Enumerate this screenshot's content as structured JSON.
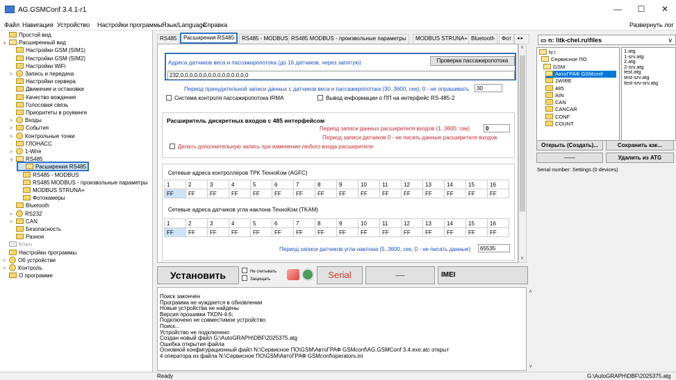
{
  "window": {
    "title": "AG.GSMConf 3.4.1-r1",
    "minimize": "—",
    "maximize": "☐",
    "close": "✕"
  },
  "menu": {
    "items": [
      "Файл",
      "Навигация",
      "Устройство",
      "Настройки программы",
      "Язык/Language",
      "Справка"
    ],
    "expand": "Развернуть лог"
  },
  "tree": [
    {
      "label": "Простой вид",
      "icon": "folder",
      "arrow": ""
    },
    {
      "label": "Расширенный вид",
      "icon": "folder-open",
      "arrow": "∨"
    },
    {
      "label": "Настройки GSM (SIM1)",
      "icon": "folder",
      "arrow": ""
    },
    {
      "label": "Настройки GSM (SIM2)",
      "icon": "folder",
      "arrow": ""
    },
    {
      "label": "Настройки WiFi",
      "icon": "folder",
      "arrow": ""
    },
    {
      "label": "Запись и передача",
      "icon": "circle",
      "arrow": ">"
    },
    {
      "label": "Настройки сервера",
      "icon": "folder",
      "arrow": ""
    },
    {
      "label": "Движение и остановки",
      "icon": "folder",
      "arrow": ""
    },
    {
      "label": "Качество вождения",
      "icon": "folder",
      "arrow": ""
    },
    {
      "label": "Голосовая связь",
      "icon": "folder",
      "arrow": ""
    },
    {
      "label": "Приоритеты в роуминге",
      "icon": "folder",
      "arrow": ""
    },
    {
      "label": "Входы",
      "icon": "circle",
      "arrow": ">"
    },
    {
      "label": "События",
      "icon": "folder",
      "arrow": ">"
    },
    {
      "label": "Контрольные точки",
      "icon": "circle",
      "arrow": ">"
    },
    {
      "label": "ГЛОНАСС",
      "icon": "folder",
      "arrow": ""
    },
    {
      "label": "1-Wire",
      "icon": "circle",
      "arrow": ">"
    },
    {
      "label": "RS485",
      "icon": "folder-open",
      "arrow": "∨"
    },
    {
      "label": "Расширения RS485",
      "icon": "folder-open",
      "arrow": ""
    },
    {
      "label": "RS485 - MODBUS",
      "icon": "folder",
      "arrow": ""
    },
    {
      "label": "RS485 MODBUS - произвольные параметры",
      "icon": "folder",
      "arrow": ""
    },
    {
      "label": "MODBUS STRUNA+",
      "icon": "folder",
      "arrow": ""
    },
    {
      "label": "Фотокамеры",
      "icon": "folder",
      "arrow": ""
    },
    {
      "label": "Bluetooth",
      "icon": "folder",
      "arrow": ""
    },
    {
      "label": "RS232",
      "icon": "circle",
      "arrow": ">"
    },
    {
      "label": "CAN",
      "icon": "folder",
      "arrow": ">"
    },
    {
      "label": "Безопасность",
      "icon": "folder",
      "arrow": ""
    },
    {
      "label": "Разное",
      "icon": "folder",
      "arrow": ""
    },
    {
      "label": "Ключ",
      "icon": "folder-gray",
      "arrow": ""
    },
    {
      "label": "Настройки программы",
      "icon": "folder",
      "arrow": ""
    },
    {
      "label": "Об устройстве",
      "icon": "circle",
      "arrow": ">"
    },
    {
      "label": "Контроль",
      "icon": "circle",
      "arrow": ">"
    },
    {
      "label": "О программе",
      "icon": "folder",
      "arrow": ""
    }
  ],
  "tabs": [
    "RS485",
    "Расширения RS485",
    "RS485 - MODBUS",
    "RS485 MODBUS - произвольные параметры",
    "MODBUS STRUNA+",
    "Bluetooth",
    "Фот"
  ],
  "tab_arrows": "◂ ▸",
  "panel": {
    "weight_label": "Адреса датчиков веса и пассажиропотока (до 16 датчиков, через запятую)",
    "check_btn": "Проверка пассажиропотока",
    "weight_value": "232,0,0,0,0,0,0,0,0,0,0,0,0,0,0,0",
    "period_label": "Период принудительной записи данных с датчиков веса и пассажиропотока (30..3600, сек), 0 - не опрашивать",
    "period_value": "30",
    "irma_label": "Система контроля пассажиропотока IRMA",
    "pp_label": "Вывод информации о ПП на интерфейс RS-485-2",
    "expander_title": "Расширитель дискретных входов с 485 интерфейсом",
    "exp_period_label": "Период записи данных расширителя входов (1..3600, сек)",
    "exp_period_value": "0",
    "exp_note": "Период записи датчиков 0 - не писать данные расширителя входов",
    "exp_extra": "Делать дополнительную запись при изменении любого входа расширителя",
    "agfc_label": "Сетевые адреса контроллеров ТРК ТехноКом (AGFC)",
    "tkam_label": "Сетевые адреса датчиков угла наклона ТехноКом (TKAM)",
    "tilt_label": "Период записи датчиков угла наклона (5..3600, сек, 0 - не писать данные)",
    "tilt_value": "65535",
    "nums": [
      "1",
      "2",
      "3",
      "4",
      "5",
      "6",
      "7",
      "8",
      "9",
      "10",
      "11",
      "12",
      "13",
      "14",
      "15",
      "16"
    ],
    "ff": "FF"
  },
  "toolbar": {
    "install": "Установить",
    "no_read": "Не считывать",
    "protect": "Защищать",
    "serial": "Serial",
    "dash": "—",
    "imei": "IMEI"
  },
  "log": [
    "Поиск закончен",
    "Программа не нуждается в обновлении",
    "Новые устройства не найдены",
    "Версия прошивки TKDN-4.6;",
    "Подключено не совместимое устройство",
    "Поиск...",
    "Устройство не подключено",
    "Создан новый файл G:\\AutoGRAPH\\DBF\\2025375.atg",
    "Ошибка открытия файла",
    "Основной конфигурационный файл N:\\Сервисное ПО\\GSM\\АвтоГРАФ GSMconf\\AG.GSMConf 3.4.exe.atc открыт",
    "4 оператора из файла N:\\Сервисное ПО\\GSM\\АвтоГРАФ GSMconf\\operators.ini"
  ],
  "right": {
    "drive": "n: \\\\tk-chel.ru\\files",
    "dirs": [
      "N:\\",
      "Сервисное ПО",
      "GSM",
      "АвтоГРАФ GSMconf",
      "1WIRE",
      "485",
      "AIN",
      "CAN",
      "CANCAR",
      "CONF",
      "COUNT"
    ],
    "files": [
      "1.atg",
      "1-srv.atg",
      "2.atg",
      "2-srv.atg",
      "test.atg",
      "test-srv.atg",
      "test-srv-srv.atg"
    ],
    "open_btn": "Открыть (Создать)...",
    "save_btn": "Сохранить как...",
    "dash_btn": "——",
    "del_btn": "Удалить из ATG",
    "serial_info": "Serial number: Settings (0 devices)"
  },
  "status": {
    "ready": "Ready",
    "path": "G:\\AutoGRAPH\\DBF\\2025375.atg"
  },
  "colors": {
    "accent": "#2f6fbf",
    "link": "#1a4fbf",
    "serial_red": "#d9342b"
  }
}
